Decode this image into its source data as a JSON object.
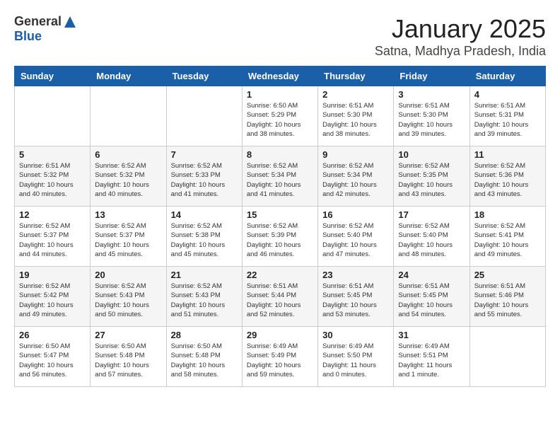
{
  "logo": {
    "general": "General",
    "blue": "Blue"
  },
  "header": {
    "title": "January 2025",
    "subtitle": "Satna, Madhya Pradesh, India"
  },
  "weekdays": [
    "Sunday",
    "Monday",
    "Tuesday",
    "Wednesday",
    "Thursday",
    "Friday",
    "Saturday"
  ],
  "weeks": [
    [
      {
        "day": "",
        "sunrise": "",
        "sunset": "",
        "daylight": ""
      },
      {
        "day": "",
        "sunrise": "",
        "sunset": "",
        "daylight": ""
      },
      {
        "day": "",
        "sunrise": "",
        "sunset": "",
        "daylight": ""
      },
      {
        "day": "1",
        "sunrise": "Sunrise: 6:50 AM",
        "sunset": "Sunset: 5:29 PM",
        "daylight": "Daylight: 10 hours and 38 minutes."
      },
      {
        "day": "2",
        "sunrise": "Sunrise: 6:51 AM",
        "sunset": "Sunset: 5:30 PM",
        "daylight": "Daylight: 10 hours and 38 minutes."
      },
      {
        "day": "3",
        "sunrise": "Sunrise: 6:51 AM",
        "sunset": "Sunset: 5:30 PM",
        "daylight": "Daylight: 10 hours and 39 minutes."
      },
      {
        "day": "4",
        "sunrise": "Sunrise: 6:51 AM",
        "sunset": "Sunset: 5:31 PM",
        "daylight": "Daylight: 10 hours and 39 minutes."
      }
    ],
    [
      {
        "day": "5",
        "sunrise": "Sunrise: 6:51 AM",
        "sunset": "Sunset: 5:32 PM",
        "daylight": "Daylight: 10 hours and 40 minutes."
      },
      {
        "day": "6",
        "sunrise": "Sunrise: 6:52 AM",
        "sunset": "Sunset: 5:32 PM",
        "daylight": "Daylight: 10 hours and 40 minutes."
      },
      {
        "day": "7",
        "sunrise": "Sunrise: 6:52 AM",
        "sunset": "Sunset: 5:33 PM",
        "daylight": "Daylight: 10 hours and 41 minutes."
      },
      {
        "day": "8",
        "sunrise": "Sunrise: 6:52 AM",
        "sunset": "Sunset: 5:34 PM",
        "daylight": "Daylight: 10 hours and 41 minutes."
      },
      {
        "day": "9",
        "sunrise": "Sunrise: 6:52 AM",
        "sunset": "Sunset: 5:34 PM",
        "daylight": "Daylight: 10 hours and 42 minutes."
      },
      {
        "day": "10",
        "sunrise": "Sunrise: 6:52 AM",
        "sunset": "Sunset: 5:35 PM",
        "daylight": "Daylight: 10 hours and 43 minutes."
      },
      {
        "day": "11",
        "sunrise": "Sunrise: 6:52 AM",
        "sunset": "Sunset: 5:36 PM",
        "daylight": "Daylight: 10 hours and 43 minutes."
      }
    ],
    [
      {
        "day": "12",
        "sunrise": "Sunrise: 6:52 AM",
        "sunset": "Sunset: 5:37 PM",
        "daylight": "Daylight: 10 hours and 44 minutes."
      },
      {
        "day": "13",
        "sunrise": "Sunrise: 6:52 AM",
        "sunset": "Sunset: 5:37 PM",
        "daylight": "Daylight: 10 hours and 45 minutes."
      },
      {
        "day": "14",
        "sunrise": "Sunrise: 6:52 AM",
        "sunset": "Sunset: 5:38 PM",
        "daylight": "Daylight: 10 hours and 45 minutes."
      },
      {
        "day": "15",
        "sunrise": "Sunrise: 6:52 AM",
        "sunset": "Sunset: 5:39 PM",
        "daylight": "Daylight: 10 hours and 46 minutes."
      },
      {
        "day": "16",
        "sunrise": "Sunrise: 6:52 AM",
        "sunset": "Sunset: 5:40 PM",
        "daylight": "Daylight: 10 hours and 47 minutes."
      },
      {
        "day": "17",
        "sunrise": "Sunrise: 6:52 AM",
        "sunset": "Sunset: 5:40 PM",
        "daylight": "Daylight: 10 hours and 48 minutes."
      },
      {
        "day": "18",
        "sunrise": "Sunrise: 6:52 AM",
        "sunset": "Sunset: 5:41 PM",
        "daylight": "Daylight: 10 hours and 49 minutes."
      }
    ],
    [
      {
        "day": "19",
        "sunrise": "Sunrise: 6:52 AM",
        "sunset": "Sunset: 5:42 PM",
        "daylight": "Daylight: 10 hours and 49 minutes."
      },
      {
        "day": "20",
        "sunrise": "Sunrise: 6:52 AM",
        "sunset": "Sunset: 5:43 PM",
        "daylight": "Daylight: 10 hours and 50 minutes."
      },
      {
        "day": "21",
        "sunrise": "Sunrise: 6:52 AM",
        "sunset": "Sunset: 5:43 PM",
        "daylight": "Daylight: 10 hours and 51 minutes."
      },
      {
        "day": "22",
        "sunrise": "Sunrise: 6:51 AM",
        "sunset": "Sunset: 5:44 PM",
        "daylight": "Daylight: 10 hours and 52 minutes."
      },
      {
        "day": "23",
        "sunrise": "Sunrise: 6:51 AM",
        "sunset": "Sunset: 5:45 PM",
        "daylight": "Daylight: 10 hours and 53 minutes."
      },
      {
        "day": "24",
        "sunrise": "Sunrise: 6:51 AM",
        "sunset": "Sunset: 5:45 PM",
        "daylight": "Daylight: 10 hours and 54 minutes."
      },
      {
        "day": "25",
        "sunrise": "Sunrise: 6:51 AM",
        "sunset": "Sunset: 5:46 PM",
        "daylight": "Daylight: 10 hours and 55 minutes."
      }
    ],
    [
      {
        "day": "26",
        "sunrise": "Sunrise: 6:50 AM",
        "sunset": "Sunset: 5:47 PM",
        "daylight": "Daylight: 10 hours and 56 minutes."
      },
      {
        "day": "27",
        "sunrise": "Sunrise: 6:50 AM",
        "sunset": "Sunset: 5:48 PM",
        "daylight": "Daylight: 10 hours and 57 minutes."
      },
      {
        "day": "28",
        "sunrise": "Sunrise: 6:50 AM",
        "sunset": "Sunset: 5:48 PM",
        "daylight": "Daylight: 10 hours and 58 minutes."
      },
      {
        "day": "29",
        "sunrise": "Sunrise: 6:49 AM",
        "sunset": "Sunset: 5:49 PM",
        "daylight": "Daylight: 10 hours and 59 minutes."
      },
      {
        "day": "30",
        "sunrise": "Sunrise: 6:49 AM",
        "sunset": "Sunset: 5:50 PM",
        "daylight": "Daylight: 11 hours and 0 minutes."
      },
      {
        "day": "31",
        "sunrise": "Sunrise: 6:49 AM",
        "sunset": "Sunset: 5:51 PM",
        "daylight": "Daylight: 11 hours and 1 minute."
      },
      {
        "day": "",
        "sunrise": "",
        "sunset": "",
        "daylight": ""
      }
    ]
  ]
}
